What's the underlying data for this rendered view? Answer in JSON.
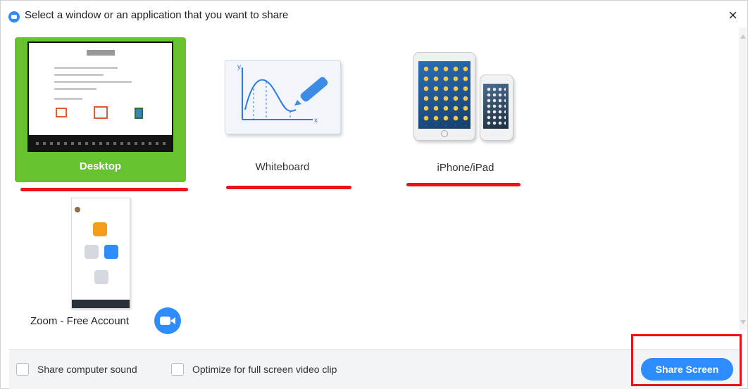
{
  "dialog": {
    "title": "Select a window or an application that you want to share",
    "close_symbol": "×"
  },
  "tiles": {
    "desktop": {
      "label": "Desktop",
      "selected": true
    },
    "whiteboard": {
      "label": "Whiteboard"
    },
    "iphone": {
      "label": "iPhone/iPad"
    },
    "zoom": {
      "label": "Zoom - Free Account"
    }
  },
  "footer": {
    "share_sound_label": "Share computer sound",
    "optimize_label": "Optimize for full screen video clip",
    "share_button_label": "Share Screen"
  },
  "colors": {
    "selected_tile": "#66c22e",
    "accent": "#2d8cff",
    "annotation_red": "#e8121b"
  },
  "icons": [
    "zoom-app-icon",
    "close-icon",
    "whiteboard-icon",
    "devices-icon",
    "zoom-camera-icon"
  ]
}
